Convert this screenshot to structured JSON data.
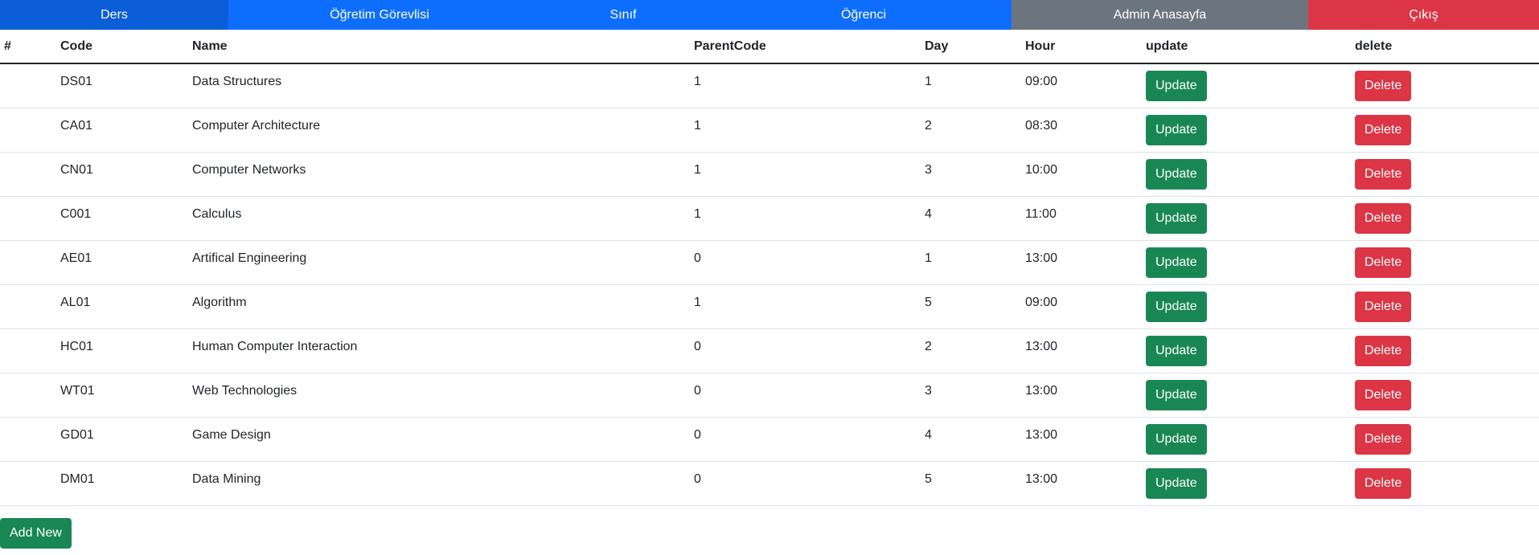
{
  "nav": {
    "ders": "Ders",
    "ogretim": "Öğretim Görevlisi",
    "sinif": "Sınıf",
    "ogrenci": "Öğrenci",
    "admin": "Admin Anasayfa",
    "cikis": "Çıkış"
  },
  "table": {
    "headers": [
      "#",
      "Code",
      "Name",
      "ParentCode",
      "Day",
      "Hour",
      "update",
      "delete"
    ],
    "rows": [
      {
        "code": "DS01",
        "name": "Data Structures",
        "parent": "1",
        "day": "1",
        "hour": "09:00"
      },
      {
        "code": "CA01",
        "name": "Computer Architecture",
        "parent": "1",
        "day": "2",
        "hour": "08:30"
      },
      {
        "code": "CN01",
        "name": "Computer Networks",
        "parent": "1",
        "day": "3",
        "hour": "10:00"
      },
      {
        "code": "C001",
        "name": "Calculus",
        "parent": "1",
        "day": "4",
        "hour": "11:00"
      },
      {
        "code": "AE01",
        "name": "Artifical Engineering",
        "parent": "0",
        "day": "1",
        "hour": "13:00"
      },
      {
        "code": "AL01",
        "name": "Algorithm",
        "parent": "1",
        "day": "5",
        "hour": "09:00"
      },
      {
        "code": "HC01",
        "name": "Human Computer Interaction",
        "parent": "0",
        "day": "2",
        "hour": "13:00"
      },
      {
        "code": "WT01",
        "name": "Web Technologies",
        "parent": "0",
        "day": "3",
        "hour": "13:00"
      },
      {
        "code": "GD01",
        "name": "Game Design",
        "parent": "0",
        "day": "4",
        "hour": "13:00"
      },
      {
        "code": "DM01",
        "name": "Data Mining",
        "parent": "0",
        "day": "5",
        "hour": "13:00"
      }
    ],
    "update_label": "Update",
    "delete_label": "Delete"
  },
  "add_new_label": "Add New",
  "colors": {
    "primary": "#0d6efd",
    "primary_active": "#0b5ed7",
    "secondary": "#6c757d",
    "danger": "#dc3545",
    "success": "#198754"
  }
}
